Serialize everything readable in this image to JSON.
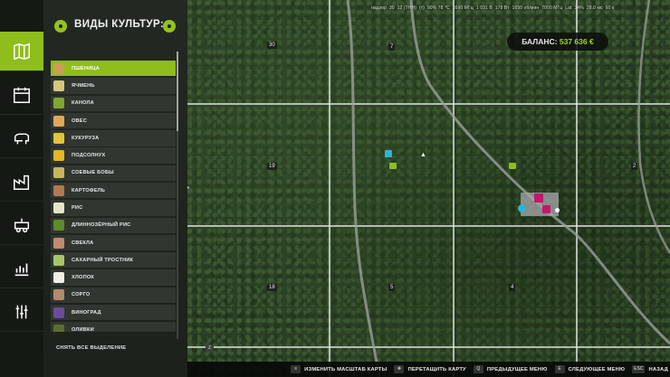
{
  "panel": {
    "title": "ВИДЫ КУЛЬТУР:",
    "clear_selection_label": "СНЯТЬ ВСЕ ВЫДЕЛЕНИЕ",
    "clear_selection_key": "Z",
    "crops": [
      {
        "label": "ПШЕНИЦА",
        "color": "#c9a052",
        "selected": true
      },
      {
        "label": "ЯЧМЕНЬ",
        "color": "#d6c77a",
        "selected": false
      },
      {
        "label": "КАНОЛА",
        "color": "#7ea830",
        "selected": false
      },
      {
        "label": "ОВЕС",
        "color": "#e0a75a",
        "selected": false
      },
      {
        "label": "КУКУРУЗА",
        "color": "#e2c43a",
        "selected": false
      },
      {
        "label": "ПОДСОЛНУХ",
        "color": "#e3b625",
        "selected": false
      },
      {
        "label": "СОЕВЫЕ БОБЫ",
        "color": "#c6b55a",
        "selected": false
      },
      {
        "label": "КАРТОФЕЛЬ",
        "color": "#b07a50",
        "selected": false
      },
      {
        "label": "РИС",
        "color": "#e8e4c8",
        "selected": false
      },
      {
        "label": "ДЛИННОЗЁРНЫЙ РИС",
        "color": "#5e8c2a",
        "selected": false
      },
      {
        "label": "СВЕКЛА",
        "color": "#c08a72",
        "selected": false
      },
      {
        "label": "САХАРНЫЙ ТРОСТНИК",
        "color": "#a8c46a",
        "selected": false
      },
      {
        "label": "ХЛОПОК",
        "color": "#f0efe6",
        "selected": false
      },
      {
        "label": "СОРГО",
        "color": "#b58a6a",
        "selected": false
      },
      {
        "label": "ВИНОГРАД",
        "color": "#6b4c9a",
        "selected": false
      },
      {
        "label": "ОЛИВКИ",
        "color": "#5a6e30",
        "selected": false
      }
    ]
  },
  "rail": {
    "items": [
      {
        "icon": "map-icon",
        "active": true
      },
      {
        "icon": "calendar-icon",
        "active": false
      },
      {
        "icon": "animals-icon",
        "active": false
      },
      {
        "icon": "production-icon",
        "active": false
      },
      {
        "icon": "vehicle-icon",
        "active": false
      },
      {
        "icon": "chart-icon",
        "active": false
      },
      {
        "icon": "finance-icon",
        "active": false
      }
    ]
  },
  "status": {
    "items": [
      "надзор",
      "30",
      "12 (ТНН)",
      "(т)",
      "90% 78 °С",
      "1690 МГц",
      "1 031 В",
      "178 Вт",
      "1650 об/мин",
      "7000 МГц",
      "Lat",
      "34%",
      "28.0 мс",
      "60 к"
    ]
  },
  "balance": {
    "label": "БАЛАНС:",
    "value": "537 636 €"
  },
  "map_labels": [
    "30",
    "7",
    "19",
    "2",
    "18",
    "5",
    "4"
  ],
  "hints": [
    {
      "key": "≡",
      "label": "ИЗМЕНИТЬ МАСШТАБ КАРТЫ"
    },
    {
      "key": "✥",
      "label": "ПЕРЕТАЩИТЬ КАРТУ"
    },
    {
      "key": "Q",
      "label": "ПРЕДЫДУЩЕЕ МЕНЮ"
    },
    {
      "key": "E",
      "label": "СЛЕДУЮЩЕЕ МЕНЮ"
    },
    {
      "key": "ESC",
      "label": "НАЗАД"
    }
  ],
  "colors": {
    "accent": "#8fbd1c",
    "balance_value": "#a6d41e",
    "panel_bg": "#1e231d",
    "marker_magenta": "#c2186c",
    "marker_cyan": "#28b6d8",
    "marker_green": "#8fbd1c"
  }
}
